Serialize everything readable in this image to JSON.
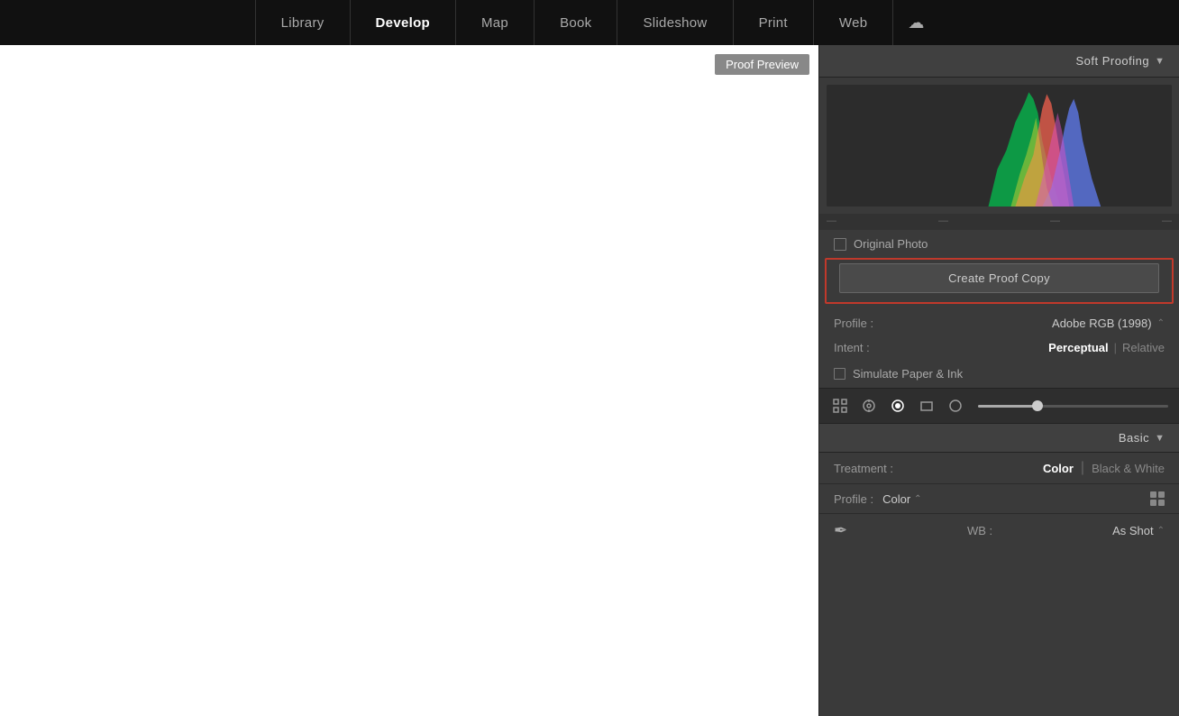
{
  "nav": {
    "items": [
      {
        "label": "Library",
        "active": false
      },
      {
        "label": "Develop",
        "active": true
      },
      {
        "label": "Map",
        "active": false
      },
      {
        "label": "Book",
        "active": false
      },
      {
        "label": "Slideshow",
        "active": false
      },
      {
        "label": "Print",
        "active": false
      },
      {
        "label": "Web",
        "active": false
      }
    ]
  },
  "canvas": {
    "proof_preview_badge": "Proof Preview"
  },
  "right_panel": {
    "soft_proofing_title": "Soft Proofing",
    "original_photo_label": "Original Photo",
    "create_proof_copy_label": "Create Proof Copy",
    "profile_label": "Profile :",
    "profile_value": "Adobe RGB (1998)",
    "intent_label": "Intent :",
    "intent_perceptual": "Perceptual",
    "intent_relative": "Relative",
    "simulate_label": "Simulate Paper & Ink",
    "basic_title": "Basic",
    "treatment_label": "Treatment :",
    "treatment_color": "Color",
    "treatment_bw": "Black & White",
    "profile_row_label": "Profile :",
    "profile_row_value": "Color",
    "wb_label": "WB :",
    "wb_value": "As Shot",
    "hist_ticks": [
      "-",
      "-",
      "-",
      "-"
    ]
  }
}
